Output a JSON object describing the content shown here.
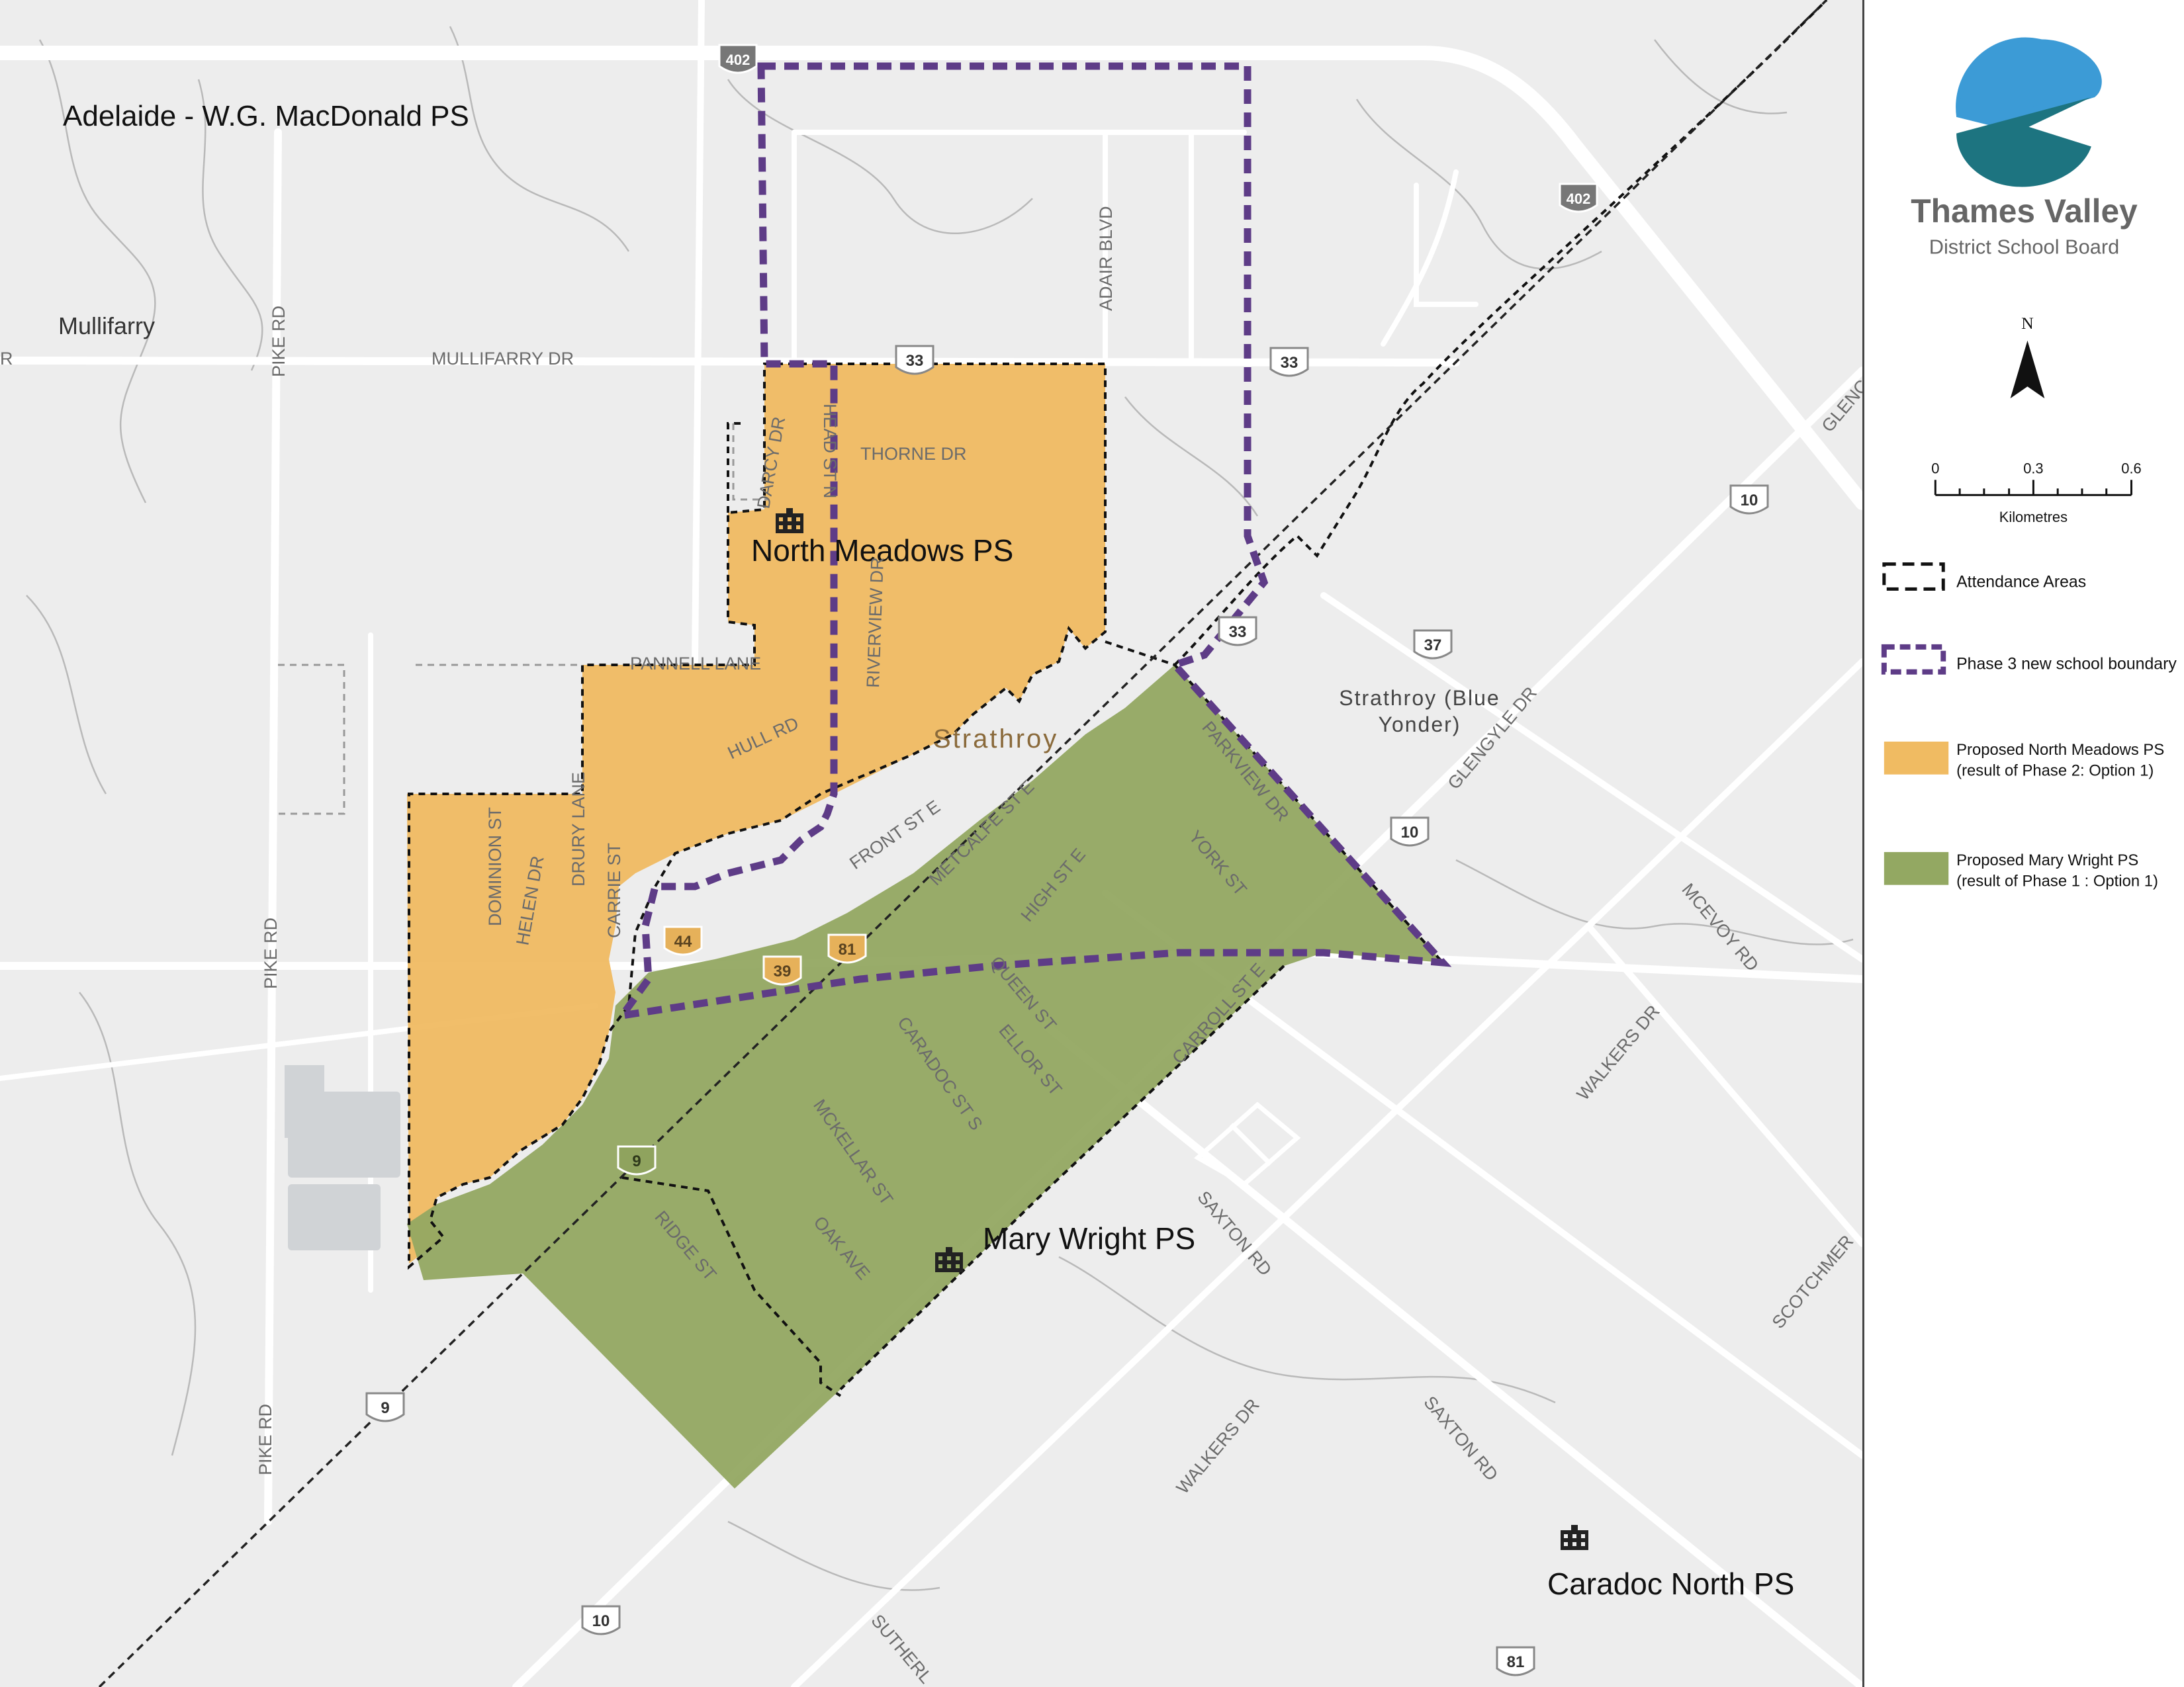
{
  "map": {
    "area_title": "Adelaide - W.G. MacDonald PS",
    "places": {
      "mullifarry": "Mullifarry",
      "strathroy": "Strathroy",
      "blue_yonder_line1": "Strathroy (Blue",
      "blue_yonder_line2": "Yonder)"
    },
    "schools": [
      {
        "name": "North Meadows PS"
      },
      {
        "name": "Mary Wright PS"
      },
      {
        "name": "Caradoc North PS"
      }
    ],
    "roads": {
      "mullifarry_dr": "MULLIFARRY DR",
      "pike_rd": "PIKE RD",
      "adair_blvd": "ADAIR BLVD",
      "thorne_dr": "THORNE DR",
      "darcy_dr": "DARCY DR",
      "head_st_n": "HEAD ST N",
      "riverview_dr": "RIVERVIEW DR",
      "pannell_lane": "PANNELL LANE",
      "hull_rd": "HULL RD",
      "dominion_st": "DOMINION ST",
      "helen_dr": "HELEN DR",
      "drury_lane": "DRURY LANE",
      "carrie_st": "CARRIE ST",
      "front_st_e": "FRONT ST E",
      "metcalfe_st_e": "METCALFE ST E",
      "high_st_e": "HIGH ST E",
      "york_st": "YORK ST",
      "parkview_dr": "PARKVIEW DR",
      "queen_st": "QUEEN ST",
      "ellor_st": "ELLOR ST",
      "caradoc_st_s": "CARADOC ST S",
      "carroll_st_e": "CARROLL ST E",
      "mckellar_st": "MCKELLAR ST",
      "oak_ave": "OAK AVE",
      "ridge_st": "RIDGE ST",
      "glengyle_dr": "GLENGYLE DR",
      "mcevoy_rd": "MCEVOY RD",
      "walkers_dr": "WALKERS DR",
      "saxton_rd": "SAXTON RD",
      "glenc": "GLENC",
      "scotchmer": "SCOTCHMER",
      "sutherl": "SUTHERL",
      "r_edge": "R"
    },
    "shields": {
      "hwy402": "402",
      "hwy33": "33",
      "hwy10": "10",
      "hwy37": "37",
      "hwy39": "39",
      "hwy44": "44",
      "hwy81": "81",
      "hwy9": "9"
    }
  },
  "legend": {
    "org_name_line1": "Thames Valley",
    "org_name_line2": "District School Board",
    "north_label": "N",
    "scale": {
      "tick0": "0",
      "tick1": "0.3",
      "tick2": "0.6",
      "unit": "Kilometres"
    },
    "items": [
      {
        "label": "Attendance Areas"
      },
      {
        "label": "Phase 3 new school boundary"
      },
      {
        "label1": "Proposed North Meadows PS",
        "label2": "(result of Phase 2: Option 1)"
      },
      {
        "label1": "Proposed Mary Wright PS",
        "label2": "(result of Phase 1 : Option 1)"
      }
    ]
  },
  "colors": {
    "background": "#ededed",
    "road": "#ffffff",
    "north_meadows_fill": "#f0bb62",
    "mary_wright_fill": "#93a862",
    "phase3_boundary": "#5e3c87",
    "attendance_boundary": "#111111",
    "logo_blue": "#3c9bd6",
    "logo_teal": "#1d7480"
  }
}
